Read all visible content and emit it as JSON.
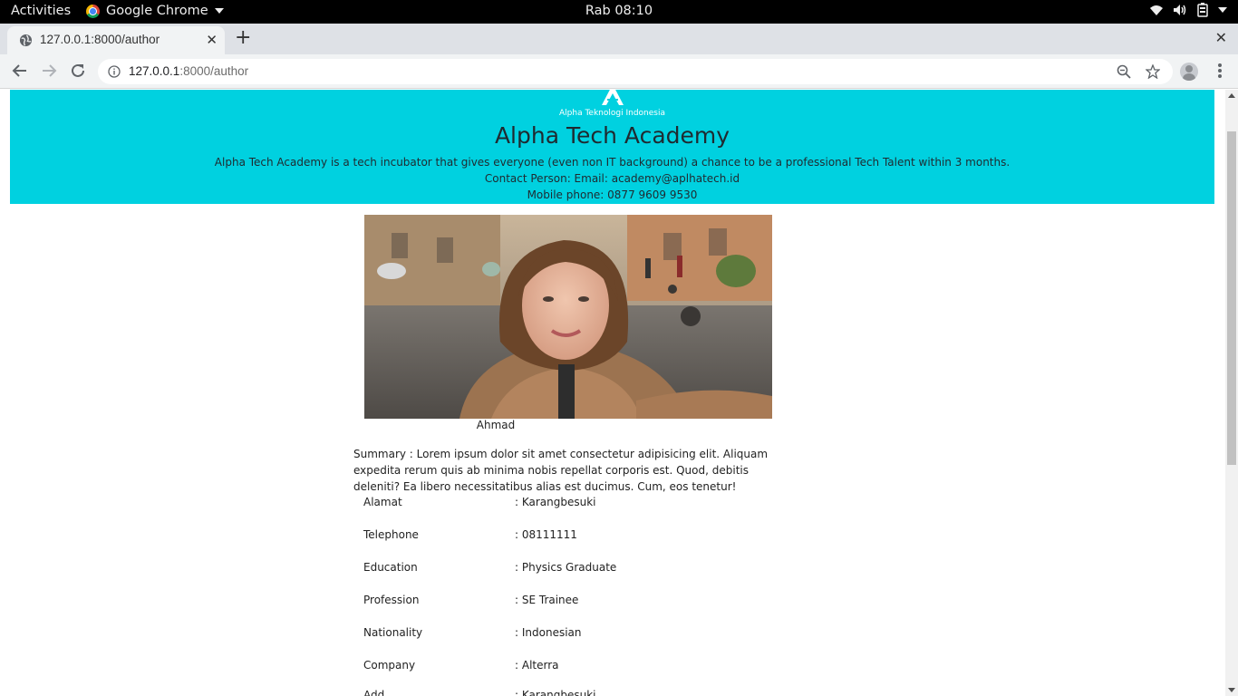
{
  "system_bar": {
    "activities": "Activities",
    "app_name": "Google Chrome",
    "clock": "Rab 08:10"
  },
  "browser": {
    "tab_title": "127.0.0.1:8000/author",
    "url_host": "127.0.0.1",
    "url_path": ":8000/author"
  },
  "banner": {
    "logo_text": "Alpha Teknologi Indonesia",
    "title": "Alpha Tech Academy",
    "description": "Alpha Tech Academy is a tech incubator that gives everyone (even non IT background) a chance to be a professional Tech Talent within 3 months.",
    "contact": "Contact Person: Email: academy@aplhatech.id",
    "mobile": "Mobile phone: 0877 9609 9530",
    "color": "#00d1e0"
  },
  "author": {
    "name": "Ahmad",
    "summary": "Summary : Lorem ipsum dolor sit amet consectetur adipisicing elit. Aliquam expedita rerum quis ab minima nobis repellat corporis est. Quod, debitis deleniti? Ea libero necessitatibus alias est ducimus. Cum, eos tenetur!",
    "details": [
      {
        "label": "Alamat",
        "value": ": Karangbesuki"
      },
      {
        "label": "Telephone",
        "value": ": 08111111"
      },
      {
        "label": "Education",
        "value": ": Physics Graduate"
      },
      {
        "label": "Profession",
        "value": ": SE Trainee"
      },
      {
        "label": "Nationality",
        "value": ": Indonesian"
      },
      {
        "label": "Company",
        "value": ": Alterra"
      },
      {
        "label": "Add",
        "value": ": Karangbesuki"
      }
    ]
  }
}
